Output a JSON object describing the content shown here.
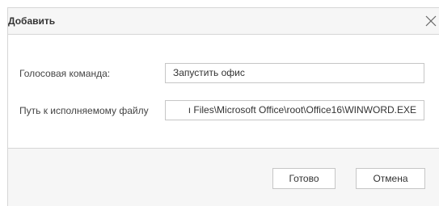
{
  "dialog": {
    "title": "Добавить",
    "close_icon": "close-icon"
  },
  "form": {
    "voice_command": {
      "label": "Голосовая команда:",
      "value": "Запустить офис"
    },
    "exe_path": {
      "label": "Путь к исполняемому файлу",
      "value": "ı Files\\Microsoft Office\\root\\Office16\\WINWORD.EXE"
    }
  },
  "buttons": {
    "ok_label": "Готово",
    "cancel_label": "Отмена"
  },
  "colors": {
    "titlebar_bg": "#f6f6f6",
    "footer_bg": "#f6f6f6",
    "border": "#d6d6d6",
    "text": "#333333"
  }
}
